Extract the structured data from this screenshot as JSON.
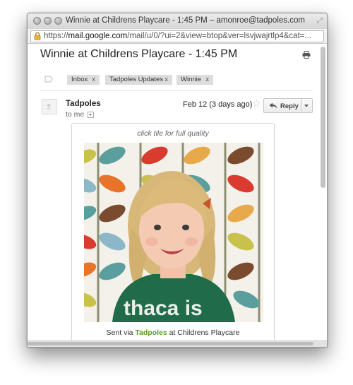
{
  "window": {
    "title": "Winnie at Childrens Playcare - 1:45 PM – amonroe@tadpoles.com –..."
  },
  "address_bar": {
    "scheme": "https://",
    "host": "mail.google.com",
    "path": "/mail/u/0/?ui=2&view=btop&ver=lsvjwajrtlp4&cat=..."
  },
  "email": {
    "subject": "Winnie at Childrens Playcare - 1:45 PM",
    "labels": [
      {
        "name": "Inbox",
        "remove": "x"
      },
      {
        "name": "Tadpoles Updates",
        "remove": "x"
      },
      {
        "name": "Winnie",
        "remove": "x"
      }
    ],
    "sender": "Tadpoles",
    "date": "Feb 12 (3 days ago)",
    "reply_label": "Reply",
    "recipient": "to me"
  },
  "card": {
    "hint": "click tile for full quality",
    "footer_prefix": "Sent via ",
    "footer_brand": "Tadpoles",
    "footer_suffix": " at Childrens Playcare"
  },
  "colors": {
    "brand_green": "#5aa02c",
    "label_chip": "#dddddd"
  },
  "icons": [
    "lock-icon",
    "printer-icon",
    "label-icon",
    "star-icon",
    "reply-arrow-icon",
    "avatar-placeholder-icon",
    "dropdown-icon"
  ]
}
